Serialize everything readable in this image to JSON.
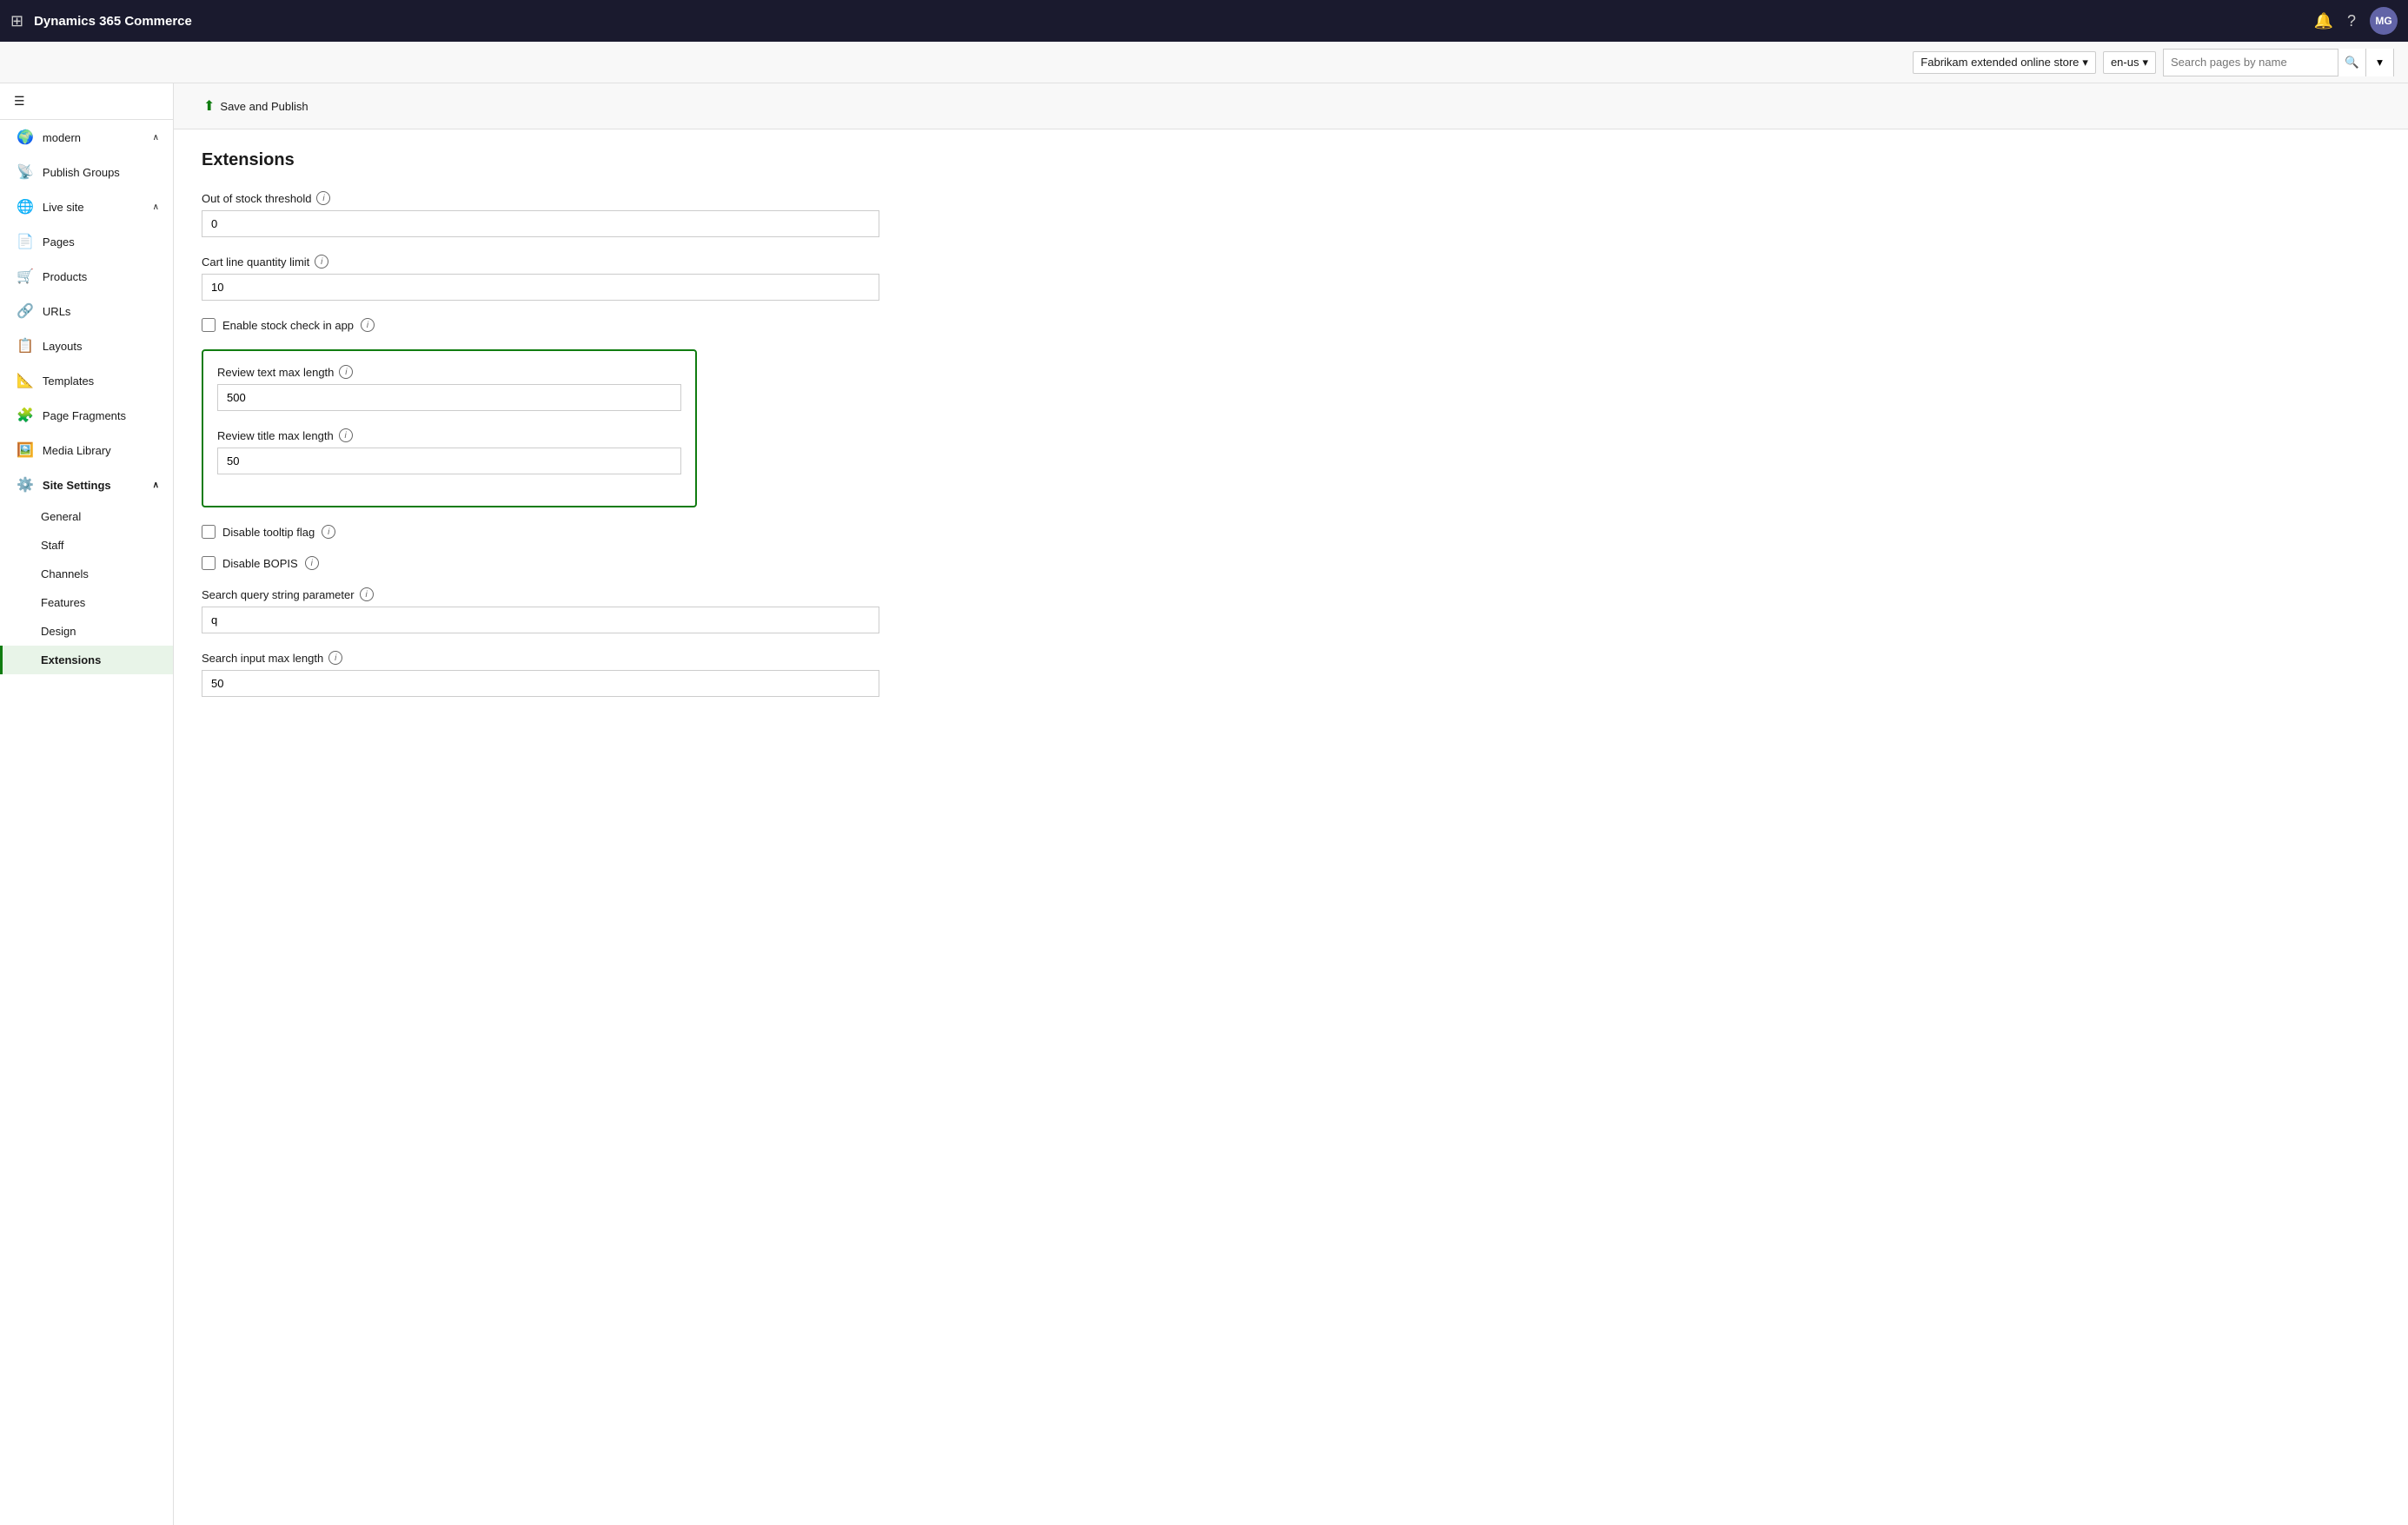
{
  "app": {
    "title": "Dynamics 365 Commerce",
    "avatar": "MG"
  },
  "topbar": {
    "store_label": "Fabrikam extended online store",
    "lang_label": "en-us",
    "search_placeholder": "Search pages by name"
  },
  "toolbar": {
    "save_publish_label": "Save and Publish"
  },
  "sidebar": {
    "site_label": "modern",
    "hamburger_label": "☰",
    "items": [
      {
        "id": "publish-groups",
        "label": "Publish Groups",
        "icon": "📡"
      },
      {
        "id": "live-site",
        "label": "Live site",
        "icon": "🌐",
        "hasChevron": true
      },
      {
        "id": "pages",
        "label": "Pages",
        "icon": "📄"
      },
      {
        "id": "products",
        "label": "Products",
        "icon": "🛒"
      },
      {
        "id": "urls",
        "label": "URLs",
        "icon": "🔗"
      },
      {
        "id": "layouts",
        "label": "Layouts",
        "icon": "📋"
      },
      {
        "id": "templates",
        "label": "Templates",
        "icon": "📐"
      },
      {
        "id": "page-fragments",
        "label": "Page Fragments",
        "icon": "🧩"
      },
      {
        "id": "media-library",
        "label": "Media Library",
        "icon": "🖼️"
      }
    ],
    "site_settings": {
      "label": "Site Settings",
      "icon": "⚙️",
      "sub_items": [
        {
          "id": "general",
          "label": "General"
        },
        {
          "id": "staff",
          "label": "Staff"
        },
        {
          "id": "channels",
          "label": "Channels"
        },
        {
          "id": "features",
          "label": "Features"
        },
        {
          "id": "design",
          "label": "Design"
        },
        {
          "id": "extensions",
          "label": "Extensions",
          "active": true
        }
      ]
    }
  },
  "content": {
    "title": "Extensions",
    "fields": [
      {
        "id": "out-of-stock-threshold",
        "label": "Out of stock threshold",
        "type": "input",
        "value": "0",
        "has_info": true
      },
      {
        "id": "cart-line-quantity-limit",
        "label": "Cart line quantity limit",
        "type": "input",
        "value": "10",
        "has_info": true
      },
      {
        "id": "enable-stock-check",
        "label": "Enable stock check in app",
        "type": "checkbox",
        "checked": false,
        "has_info": true
      },
      {
        "id": "review-text-max-length",
        "label": "Review text max length",
        "type": "input",
        "value": "500",
        "has_info": true,
        "highlighted": true
      },
      {
        "id": "review-title-max-length",
        "label": "Review title max length",
        "type": "input",
        "value": "50",
        "has_info": true,
        "highlighted": true
      },
      {
        "id": "disable-tooltip-flag",
        "label": "Disable tooltip flag",
        "type": "checkbox",
        "checked": false,
        "has_info": true
      },
      {
        "id": "disable-bopis",
        "label": "Disable BOPIS",
        "type": "checkbox",
        "checked": false,
        "has_info": true
      },
      {
        "id": "search-query-string-parameter",
        "label": "Search query string parameter",
        "type": "input",
        "value": "q",
        "has_info": true
      },
      {
        "id": "search-input-max-length",
        "label": "Search input max length",
        "type": "input",
        "value": "50",
        "has_info": true
      }
    ]
  }
}
